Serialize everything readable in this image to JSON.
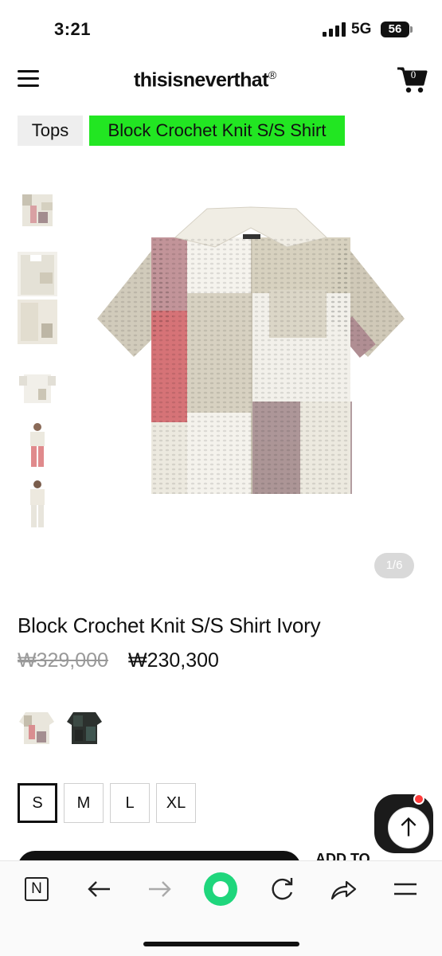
{
  "status_bar": {
    "time": "3:21",
    "network": "5G",
    "battery": "56"
  },
  "header": {
    "brand": "thisisneverthat",
    "brand_mark": "®",
    "cart_count": "0",
    "icons": [
      "menu-icon",
      "cart-icon"
    ]
  },
  "breadcrumb": [
    {
      "label": "Tops"
    },
    {
      "label": "Block Crochet Knit S/S Shirt"
    }
  ],
  "gallery": {
    "thumbnail_count": 6,
    "pager": "1/6"
  },
  "product": {
    "title": "Block Crochet Knit S/S Shirt Ivory",
    "original_price": "₩329,000",
    "sale_price": "₩230,300",
    "colors": [
      "Ivory",
      "Black"
    ],
    "sizes": [
      {
        "label": "S",
        "selected": true
      },
      {
        "label": "M",
        "selected": false
      },
      {
        "label": "L",
        "selected": false
      },
      {
        "label": "XL",
        "selected": false
      }
    ],
    "add_to_cart_label": "ADD TO"
  },
  "browser_bar": {
    "logo": "N",
    "icons": [
      "back-arrow-icon",
      "forward-arrow-icon",
      "home-icon",
      "refresh-icon",
      "share-icon",
      "menu-icon"
    ]
  },
  "colors": {
    "breadcrumb_highlight": "#22e622",
    "home_button": "#1fd67c",
    "notification": "#ff3b3b"
  }
}
